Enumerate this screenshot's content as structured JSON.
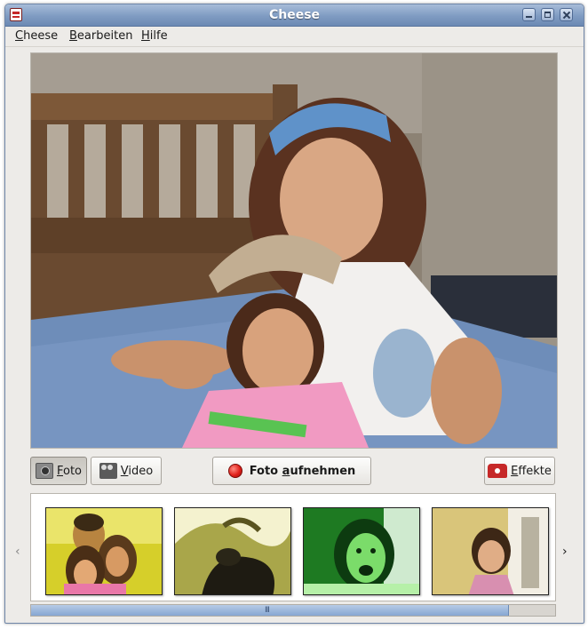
{
  "window": {
    "title": "Cheese"
  },
  "menu": {
    "items": [
      {
        "mnemonic": "C",
        "rest": "heese"
      },
      {
        "mnemonic": "B",
        "rest": "earbeiten"
      },
      {
        "mnemonic": "H",
        "rest": "ilfe"
      }
    ]
  },
  "controls": {
    "photo_mode": {
      "mnemonic": "F",
      "rest": "oto",
      "icon": "camera-icon",
      "active": true
    },
    "video_mode": {
      "mnemonic": "V",
      "rest": "ideo",
      "icon": "video-camera-icon"
    },
    "capture": {
      "pre": "Foto ",
      "mnemonic": "a",
      "rest": "ufnehmen",
      "icon": "record-icon"
    },
    "effects": {
      "mnemonic": "E",
      "rest": "ffekte",
      "icon": "effects-icon"
    }
  },
  "thumbnails": {
    "items": [
      {
        "name": "thumbnail-1"
      },
      {
        "name": "thumbnail-2"
      },
      {
        "name": "thumbnail-3"
      },
      {
        "name": "thumbnail-4"
      }
    ],
    "prev_icon": "‹",
    "next_icon": "›",
    "scroll_fraction": 0.91,
    "scroll_grip": "III"
  },
  "colors": {
    "title_blue": "#7f9bc2",
    "record_red": "#e0201a",
    "scroll_blue": "#86a6d2"
  }
}
